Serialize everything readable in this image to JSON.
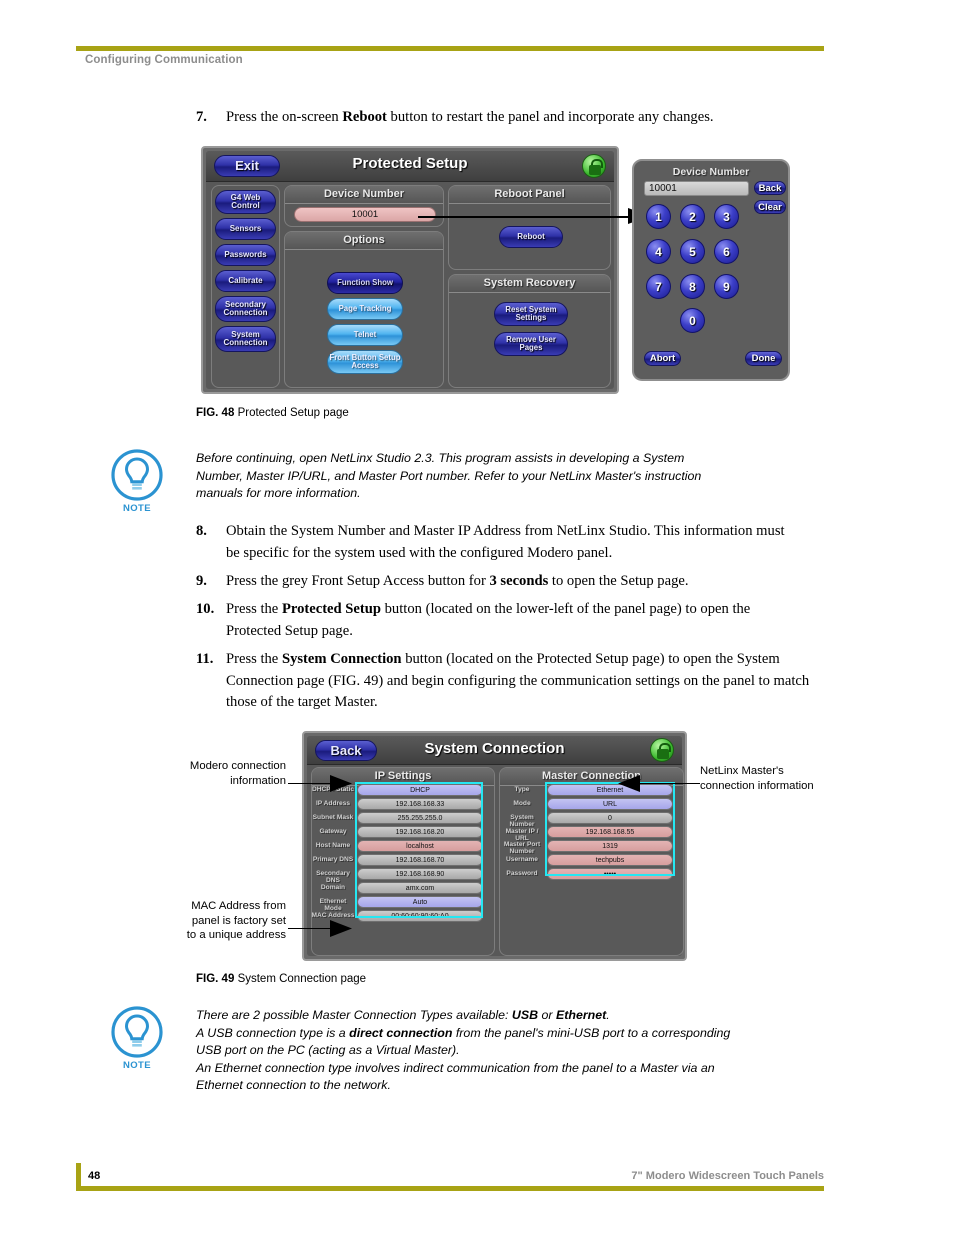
{
  "header": {
    "section_title": "Configuring Communication"
  },
  "footer": {
    "page_number": "48",
    "document_title": "7\" Modero Widescreen Touch Panels"
  },
  "steps": [
    {
      "num": "7.",
      "html": "Press the on-screen <b>Reboot</b> button to restart the panel and incorporate any changes."
    },
    {
      "num": "8.",
      "html": "Obtain the System Number and Master IP Address from NetLinx Studio. This information must be specific for the system used with the configured Modero panel."
    },
    {
      "num": "9.",
      "html": "Press the grey Front Setup Access button for <b>3 seconds</b> to open the Setup page."
    },
    {
      "num": "10.",
      "html": "Press the <b>Protected Setup</b> button (located on the lower-left of the panel page) to open the Protected Setup page."
    },
    {
      "num": "11.",
      "html": "Press the <b>System Connection</b> button (located on the Protected Setup page) to open the System Connection page (FIG. 49) and begin configuring the communication settings on the panel to match those of the target Master."
    }
  ],
  "figure48": {
    "caption_label": "FIG. 48",
    "caption_text": "Protected Setup page",
    "title": "Protected Setup",
    "exit_button": "Exit",
    "lock_icon": "lock-icon",
    "sidebar": [
      "G4 Web Control",
      "Sensors",
      "Passwords",
      "Calibrate",
      "Secondary Connection",
      "System Connection"
    ],
    "device_number_group": "Device Number",
    "device_number_value": "10001",
    "options_group": "Options",
    "options": [
      {
        "label": "Function Show",
        "style": "dark"
      },
      {
        "label": "Page Tracking",
        "style": "light"
      },
      {
        "label": "Telnet",
        "style": "light"
      },
      {
        "label": "Front Button Setup Access",
        "style": "light"
      }
    ],
    "reboot_group": "Reboot Panel",
    "reboot_button": "Reboot",
    "recovery_group": "System Recovery",
    "recovery_buttons": [
      "Reset System Settings",
      "Remove User Pages"
    ]
  },
  "keypad": {
    "title": "Device Number",
    "display_value": "10001",
    "back_button": "Back",
    "clear_button": "Clear",
    "keys": [
      "1",
      "2",
      "3",
      "4",
      "5",
      "6",
      "7",
      "8",
      "9",
      "0"
    ],
    "abort_button": "Abort",
    "done_button": "Done"
  },
  "note1": {
    "icon_label": "NOTE",
    "html": "Before continuing, open NetLinx Studio 2.3. This program assists in developing a System Number, Master IP/URL, and Master Port number. Refer to your NetLinx Master's instruction manuals for more information."
  },
  "figure49": {
    "caption_label": "FIG. 49",
    "caption_text": "System Connection page",
    "title": "System Connection",
    "back_button": "Back",
    "lock_icon": "lock-icon",
    "ip_settings_group": "IP Settings",
    "ip_settings_rows": [
      {
        "label": "DHCP / Static",
        "value": "DHCP",
        "style": "blue"
      },
      {
        "label": "IP Address",
        "value": "192.168.168.33",
        "style": "grey"
      },
      {
        "label": "Subnet Mask",
        "value": "255.255.255.0",
        "style": "grey"
      },
      {
        "label": "Gateway",
        "value": "192.168.168.20",
        "style": "grey"
      },
      {
        "label": "Host Name",
        "value": "localhost",
        "style": "pink"
      },
      {
        "label": "Primary DNS",
        "value": "192.168.168.70",
        "style": "grey"
      },
      {
        "label": "Secondary DNS",
        "value": "192.168.168.90",
        "style": "grey"
      },
      {
        "label": "Domain",
        "value": "amx.com",
        "style": "grey"
      },
      {
        "label": "Ethernet Mode",
        "value": "Auto",
        "style": "blue"
      },
      {
        "label": "MAC Address",
        "value": "00:60:60:90:60:A0",
        "style": "grey"
      }
    ],
    "master_connection_group": "Master Connection",
    "master_connection_rows": [
      {
        "label": "Type",
        "value": "Ethernet",
        "style": "blue"
      },
      {
        "label": "Mode",
        "value": "URL",
        "style": "blue"
      },
      {
        "label": "System Number",
        "value": "0",
        "style": "grey"
      },
      {
        "label": "Master IP / URL",
        "value": "192.168.168.55",
        "style": "pink"
      },
      {
        "label": "Master Port Number",
        "value": "1319",
        "style": "pink"
      },
      {
        "label": "Username",
        "value": "techpubs",
        "style": "pink"
      },
      {
        "label": "Password",
        "value": "•••••",
        "style": "pink"
      }
    ],
    "callout_left_top": "Modero connection information",
    "callout_left_bottom": "MAC Address from panel is factory set to a unique address",
    "callout_right": "NetLinx Master's connection information"
  },
  "note2": {
    "icon_label": "NOTE",
    "html": "There are 2 possible Master Connection Types available: <b>USB</b> or <b>Ethernet</b>.<br>A USB connection type is a <b>direct connection</b> from the panel's mini-USB port to a corresponding USB port on the PC (acting as a Virtual Master).<br>An Ethernet connection type involves indirect communication from the panel to a Master via an Ethernet connection to the network."
  },
  "colors": {
    "rule": "#a8a315",
    "note_accent": "#2b93d1",
    "highlight_box": "#25e7f2"
  }
}
